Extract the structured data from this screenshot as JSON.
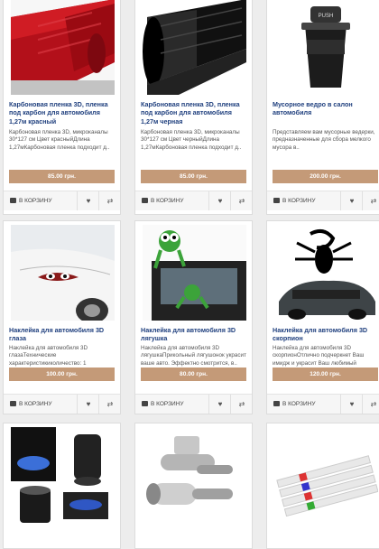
{
  "labels": {
    "cart_button": "В КОРЗИНУ",
    "wishlist_glyph": "♥",
    "compare_glyph": "⇄"
  },
  "products": [
    {
      "title": "Карбоновая пленка 3D, пленка под карбон для автомобиля 1,27м красный",
      "description": "Карбоновая пленка 3D, микроканалы 30*127 см Цвет красныйДлина 1,27мКарбоновая пленка подходит д..",
      "price": "85.00 грн.",
      "image_icon": "red-carbon-film-roll"
    },
    {
      "title": "Карбоновая пленка 3D, пленка под карбон для автомобиля 1,27м черная",
      "description": "Карбоновая пленка 3D, микроканалы 30*127 см Цвет черныйДлина 1,27мКарбоновая пленка подходит д..",
      "price": "85.00 грн.",
      "image_icon": "black-carbon-film-roll"
    },
    {
      "title": "Мусорное ведро в салон автомобиля",
      "description": "Представляем вам мусорные ведерки, предназначенные для сбора мелкого мусора в..",
      "price": "200.00 грн.",
      "image_icon": "car-trash-bin"
    },
    {
      "title": "Наклейка для автомобиля 3D глаза",
      "description": "Наклейка для автомобиля 3D глазаТехнические характеристикиколичество: 1 шт.размер: 332 x 95 мммате..",
      "price": "100.00 грн.",
      "image_icon": "car-eyes-sticker"
    },
    {
      "title": "Наклейка для автомобиля 3D лягушка",
      "description": "Наклейка для автомобиля 3D лягушкаПрикольный лягушонок украсит ваше авто. Эффектно смотрится, в..",
      "price": "80.00 грн.",
      "image_icon": "frog-sticker"
    },
    {
      "title": "Наклейка для автомобиля 3D скорпион",
      "description": "Наклейка для автомобиля 3D скорпионОтлично подчеркнет Ваш имидж и украсит Ваш любимый автомобильТехн..",
      "price": "120.00 грн.",
      "image_icon": "scorpion-sticker"
    },
    {
      "title": "",
      "description": "",
      "price": "",
      "image_icon": "car-ashtray"
    },
    {
      "title": "",
      "description": "",
      "price": "",
      "image_icon": "exhaust-whistle"
    },
    {
      "title": "",
      "description": "",
      "price": "",
      "image_icon": "paint-markers"
    }
  ],
  "colors": {
    "title": "#21417f",
    "price_bg": "#c49a78",
    "page_bg": "#ededed"
  }
}
